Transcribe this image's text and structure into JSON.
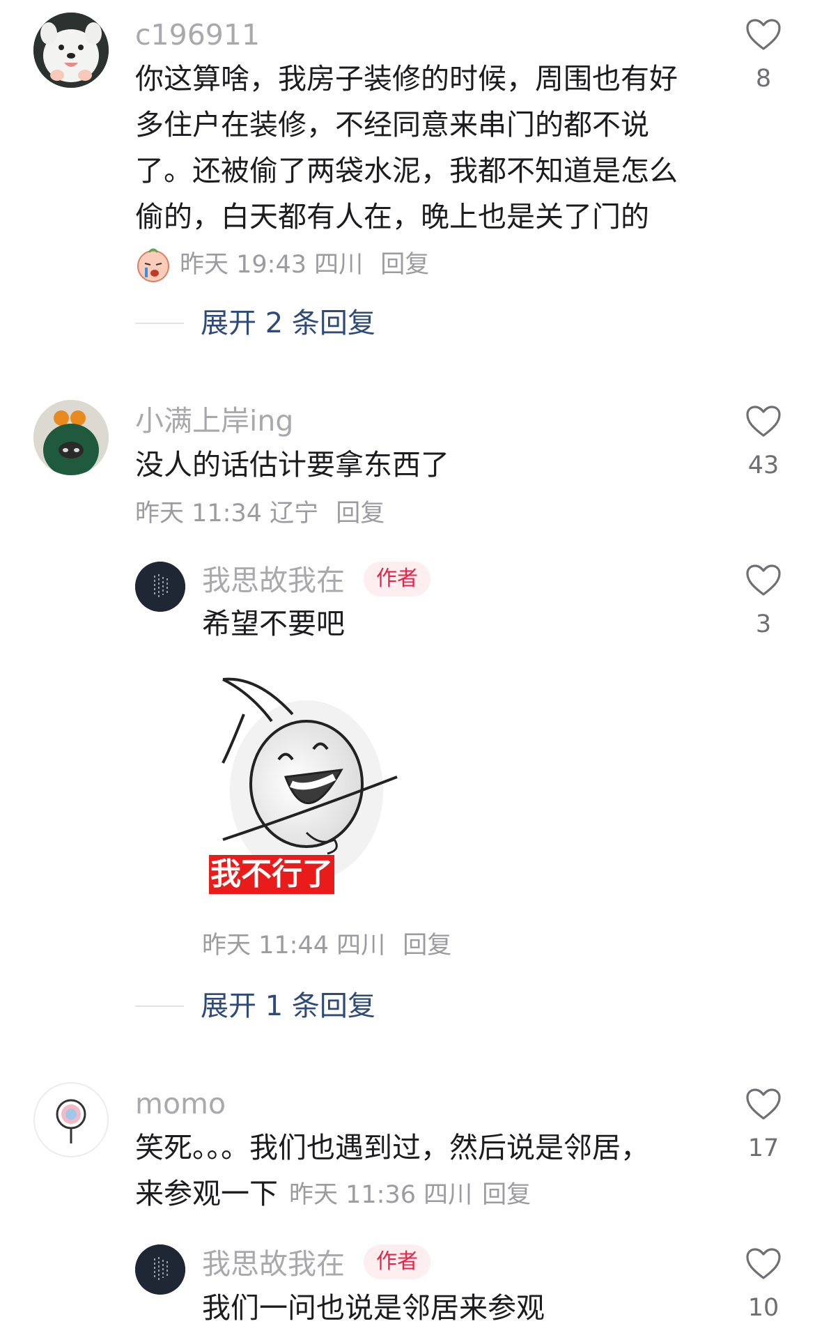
{
  "comments": [
    {
      "username": "c196911",
      "text_lines": [
        "你这算啥，我房子装修的时候，周围也有好",
        "多住户在装修，不经同意来串门的都不说",
        "了。还被偷了两袋水泥，我都不知道是怎么",
        "偷的，白天都有人在，晚上也是关了门的"
      ],
      "time": "昨天 19:43",
      "location": "四川",
      "reply_label": "回复",
      "likes": "8",
      "expand_label": "展开 2 条回复",
      "avatar_icon": "samoyed-dog-avatar",
      "emoji_icon": "crying-face-emoji"
    },
    {
      "username": "小满上岸ing",
      "text": "没人的话估计要拿东西了",
      "time": "昨天 11:34",
      "location": "辽宁",
      "reply_label": "回复",
      "likes": "43",
      "avatar_icon": "green-hood-avatar",
      "reply": {
        "username": "我思故我在",
        "badge": "作者",
        "text": "希望不要吧",
        "sticker_text": "我不行了",
        "time": "昨天 11:44",
        "location": "四川",
        "reply_label": "回复",
        "likes": "3"
      },
      "expand_label": "展开 1 条回复"
    },
    {
      "username": "momo",
      "text_line1": "笑死。。。我们也遇到过，然后说是邻居，",
      "text_line2": "来参观一下",
      "time": "昨天 11:36",
      "location": "四川",
      "reply_label": "回复",
      "likes": "17",
      "avatar_icon": "lollipop-avatar",
      "reply": {
        "username": "我思故我在",
        "badge": "作者",
        "text": "我们一问也说是邻居来参观",
        "likes": "10"
      }
    }
  ],
  "colors": {
    "username": "#a8a8ad",
    "text": "#1c1c1e",
    "meta": "#9b9ba0",
    "expand_link": "#2d4a78",
    "author_badge_bg": "#fdeef0",
    "author_badge_text": "#e8234a",
    "sticker_banner": "#ea1b1b"
  }
}
